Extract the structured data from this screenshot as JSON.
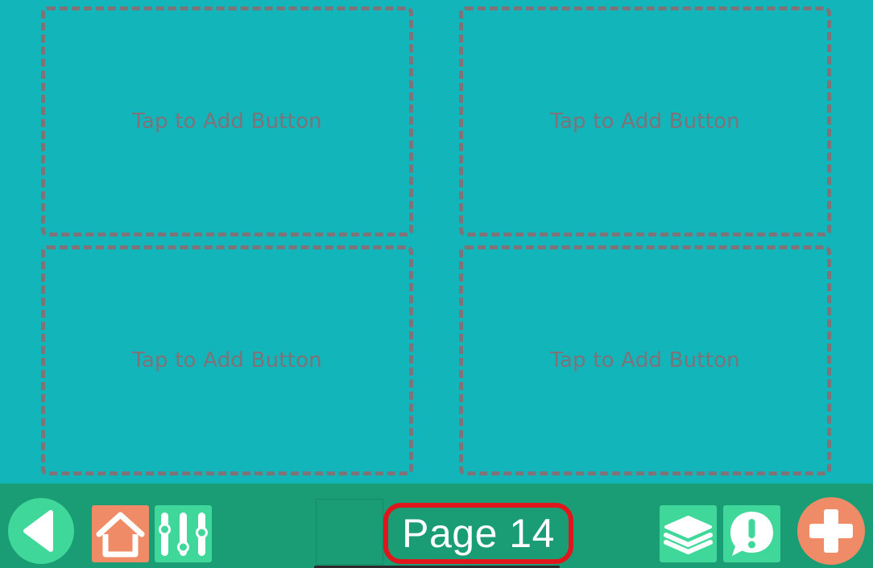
{
  "grid": {
    "slots": [
      {
        "label": "Tap to Add Button"
      },
      {
        "label": "Tap to Add Button"
      },
      {
        "label": "Tap to Add Button"
      },
      {
        "label": "Tap to Add Button"
      }
    ]
  },
  "toolbar": {
    "page_label": "Page 14",
    "icons": {
      "back": "back-arrow-icon",
      "home": "home-icon",
      "settings": "sliders-icon",
      "layers": "layers-icon",
      "alert": "alert-speech-bubble-icon",
      "add": "plus-icon"
    }
  },
  "colors": {
    "background": "#12b5b9",
    "toolbar": "#1a9d74",
    "slot_border": "#7d7379",
    "accent_green": "#3fd79a",
    "accent_orange": "#ef8c67",
    "highlight_red": "#e0161d"
  }
}
